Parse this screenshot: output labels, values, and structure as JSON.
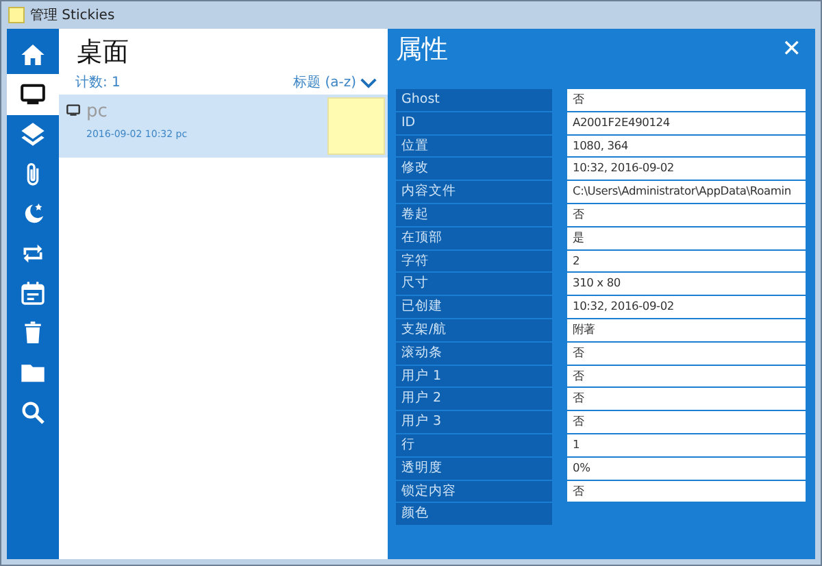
{
  "window": {
    "title": "管理 Stickies"
  },
  "sidebar": {
    "items": [
      {
        "kind": "home",
        "selected": false
      },
      {
        "kind": "desktop",
        "selected": true
      },
      {
        "kind": "layers",
        "selected": false
      },
      {
        "kind": "clip",
        "selected": false
      },
      {
        "kind": "moon",
        "selected": false
      },
      {
        "kind": "repeat",
        "selected": false
      },
      {
        "kind": "calendar",
        "selected": false
      },
      {
        "kind": "trash",
        "selected": false
      },
      {
        "kind": "folder",
        "selected": false
      },
      {
        "kind": "search",
        "selected": false
      }
    ]
  },
  "list": {
    "title": "桌面",
    "count": "计数: 1",
    "sort": "标题 (a-z)",
    "notes": [
      {
        "title": "pc",
        "meta": "2016-09-02 10:32 pc",
        "selected": true
      }
    ]
  },
  "properties": {
    "title": "属性",
    "close": "✕",
    "rows": [
      {
        "label": "Ghost",
        "value": "否"
      },
      {
        "label": "ID",
        "value": "A2001F2E490124"
      },
      {
        "label": "位置",
        "value": "1080, 364"
      },
      {
        "label": "修改",
        "value": "10:32, 2016-09-02"
      },
      {
        "label": "内容文件",
        "value": "C:\\Users\\Administrator\\AppData\\Roamin"
      },
      {
        "label": "卷起",
        "value": "否"
      },
      {
        "label": "在顶部",
        "value": "是"
      },
      {
        "label": "字符",
        "value": "2"
      },
      {
        "label": "尺寸",
        "value": "310 x 80"
      },
      {
        "label": "已创建",
        "value": "10:32, 2016-09-02"
      },
      {
        "label": "支架/航",
        "value": "附著"
      },
      {
        "label": "滚动条",
        "value": "否"
      },
      {
        "label": "用户 1",
        "value": "否"
      },
      {
        "label": "用户 2",
        "value": "否"
      },
      {
        "label": "用户 3",
        "value": "否"
      },
      {
        "label": "行",
        "value": "1"
      },
      {
        "label": "透明度",
        "value": "0%"
      },
      {
        "label": "锁定内容",
        "value": "否"
      },
      {
        "label": "颜色"
      }
    ]
  }
}
